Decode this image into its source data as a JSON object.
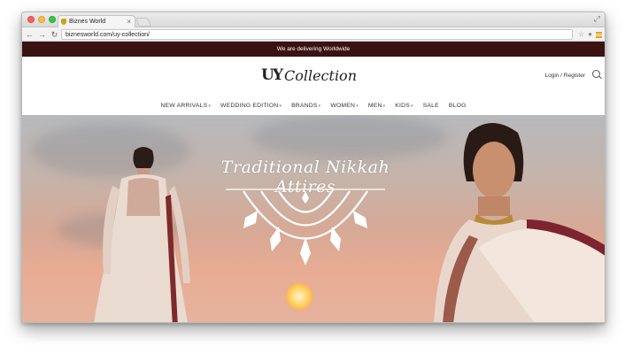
{
  "browser": {
    "tab_title": "Biznes World",
    "url": "biznesworld.com/uy-collection/",
    "icons": [
      "back-icon",
      "forward-icon",
      "reload-icon",
      "star-icon",
      "extension-icon",
      "menu-icon"
    ]
  },
  "site": {
    "announcement": "We are delivering Worldwide",
    "logo_mark": "UY",
    "logo_text": "Collection",
    "login": "Login / Register",
    "nav": [
      {
        "label": "NEW ARRIVALS",
        "dropdown": true
      },
      {
        "label": "WEDDING EDITION",
        "dropdown": true
      },
      {
        "label": "BRANDS",
        "dropdown": true
      },
      {
        "label": "WOMEN",
        "dropdown": true
      },
      {
        "label": "MEN",
        "dropdown": true
      },
      {
        "label": "KIDS",
        "dropdown": true
      },
      {
        "label": "SALE",
        "dropdown": false
      },
      {
        "label": "BLOG",
        "dropdown": false
      }
    ],
    "hero": {
      "title": "Traditional Nikkah Attires"
    }
  },
  "colors": {
    "announcement_bg": "#3b1212",
    "sky_top": "#b7b9bc",
    "sky_bottom": "#e8ac93"
  }
}
